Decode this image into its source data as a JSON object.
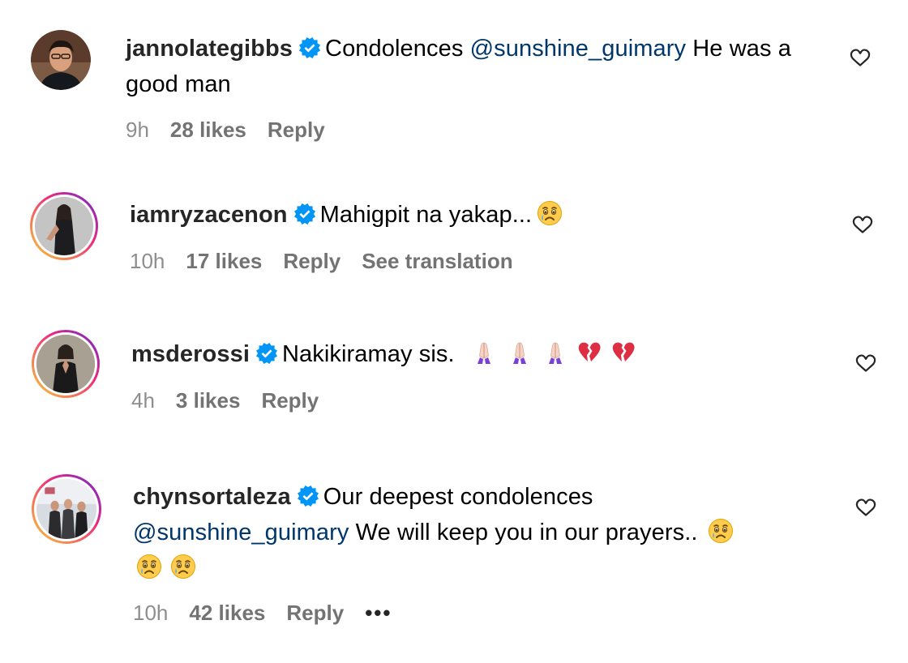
{
  "comments": [
    {
      "username": "jannolategibbs",
      "text_before": "Condolences",
      "mention": "@sunshine_guimary",
      "text_after": "He was a good man",
      "time": "9h",
      "likes": "28 likes",
      "reply": "Reply",
      "avatar_icon": "man-portrait-avatar"
    },
    {
      "username": "iamryzacenon",
      "text": "Mahigpit na yakap...",
      "emoji": "crying-face",
      "time": "10h",
      "likes": "17 likes",
      "reply": "Reply",
      "translate": "See translation",
      "avatar_icon": "woman-dark-dress-avatar"
    },
    {
      "username": "msderossi",
      "text": "Nakikiramay sis.",
      "emojis": [
        "folded-hands",
        "folded-hands",
        "folded-hands",
        "broken-heart",
        "broken-heart"
      ],
      "time": "4h",
      "likes": "3 likes",
      "reply": "Reply",
      "avatar_icon": "woman-praying-avatar"
    },
    {
      "username": "chynsortaleza",
      "text_before": "Our deepest condolences",
      "mention": "@sunshine_guimary",
      "text_after": "We will keep you in our prayers..",
      "emojis": [
        "crying-face",
        "crying-face",
        "crying-face"
      ],
      "time": "10h",
      "likes": "42 likes",
      "reply": "Reply",
      "more": "•••",
      "avatar_icon": "group-photo-avatar"
    }
  ],
  "colors": {
    "verified": "#0095f6",
    "mention": "#00376b",
    "meta": "#8e8e8e",
    "story_ring_start": "#f9ce34",
    "story_ring_mid": "#ee2a7b",
    "story_ring_end": "#6228d7"
  }
}
